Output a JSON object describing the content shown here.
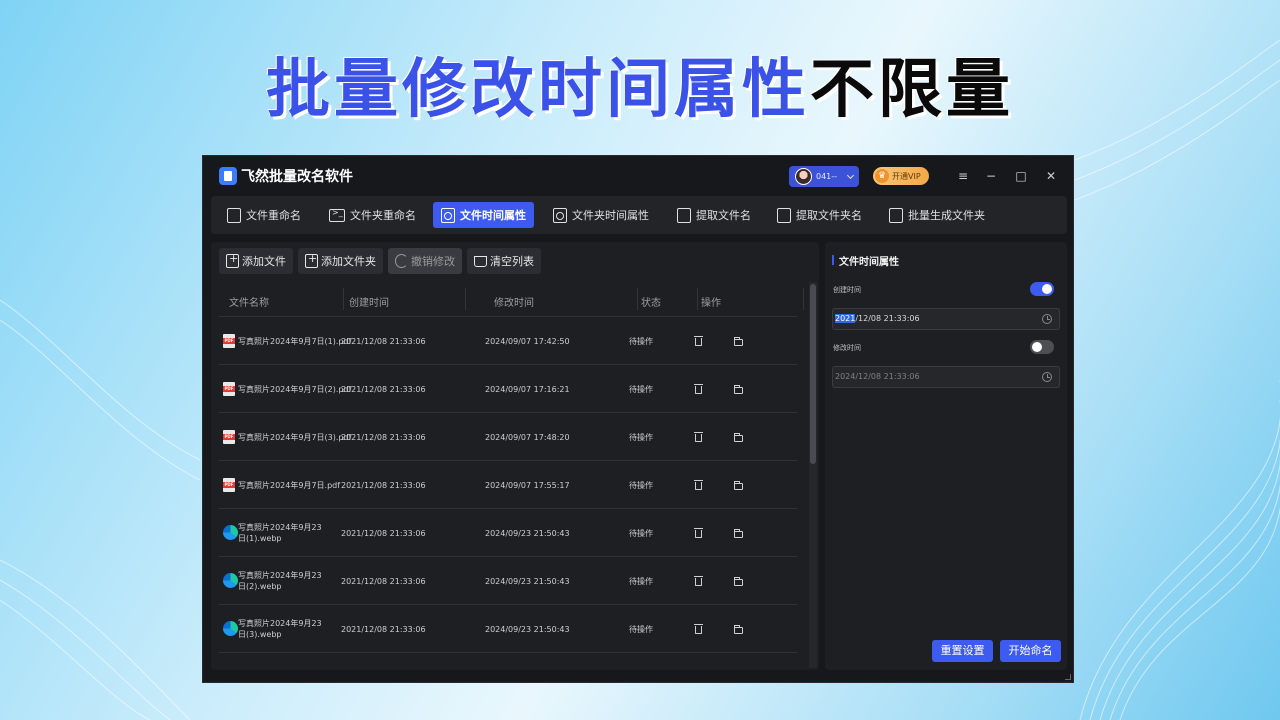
{
  "headline": {
    "blue_part": "批量修改时间属性",
    "black_part": "不限量"
  },
  "window": {
    "app_title": "飞然批量改名软件",
    "user_name": "041--",
    "vip_label": "开通VIP",
    "controls": {
      "menu": "≡",
      "minimize": "−",
      "maximize": "□",
      "close": "✕"
    }
  },
  "tabs": [
    {
      "label": "文件重命名",
      "icon": "file-icon",
      "active": false
    },
    {
      "label": "文件夹重命名",
      "icon": "terminal-folder-icon",
      "active": false
    },
    {
      "label": "文件时间属性",
      "icon": "file-clock-icon",
      "active": true
    },
    {
      "label": "文件夹时间属性",
      "icon": "folder-clock-icon",
      "active": false
    },
    {
      "label": "提取文件名",
      "icon": "extract-file-icon",
      "active": false
    },
    {
      "label": "提取文件夹名",
      "icon": "extract-folder-icon",
      "active": false
    },
    {
      "label": "批量生成文件夹",
      "icon": "generate-folder-icon",
      "active": false
    }
  ],
  "toolbar": {
    "add_file": "添加文件",
    "add_folder": "添加文件夹",
    "undo": "撤销修改",
    "clear_list": "清空列表"
  },
  "table": {
    "columns": [
      "文件名称",
      "创建时间",
      "修改时间",
      "状态",
      "操作"
    ],
    "rows": [
      {
        "type": "pdf",
        "name": "写真照片2024年9月7日(1).pdf",
        "created": "2021/12/08 21:33:06",
        "modified": "2024/09/07 17:42:50",
        "status": "待操作"
      },
      {
        "type": "pdf",
        "name": "写真照片2024年9月7日(2).pdf",
        "created": "2021/12/08 21:33:06",
        "modified": "2024/09/07 17:16:21",
        "status": "待操作"
      },
      {
        "type": "pdf",
        "name": "写真照片2024年9月7日(3).pdf",
        "created": "2021/12/08 21:33:06",
        "modified": "2024/09/07 17:48:20",
        "status": "待操作"
      },
      {
        "type": "pdf",
        "name": "写真照片2024年9月7日.pdf",
        "created": "2021/12/08 21:33:06",
        "modified": "2024/09/07 17:55:17",
        "status": "待操作"
      },
      {
        "type": "webp",
        "name": "写真照片2024年9月23日(1).webp",
        "created": "2021/12/08 21:33:06",
        "modified": "2024/09/23 21:50:43",
        "status": "待操作"
      },
      {
        "type": "webp",
        "name": "写真照片2024年9月23日(2).webp",
        "created": "2021/12/08 21:33:06",
        "modified": "2024/09/23 21:50:43",
        "status": "待操作"
      },
      {
        "type": "webp",
        "name": "写真照片2024年9月23日(3).webp",
        "created": "2021/12/08 21:33:06",
        "modified": "2024/09/23 21:50:43",
        "status": "待操作"
      }
    ]
  },
  "settings": {
    "title": "文件时间属性",
    "created_label": "创建时间",
    "created_enabled": true,
    "created_value_selected": "2021",
    "created_value_rest": "/12/08 21:33:06",
    "modified_label": "修改时间",
    "modified_enabled": false,
    "modified_value": "2024/12/08 21:33:06",
    "reset_button": "重置设置",
    "start_button": "开始命名"
  },
  "colors": {
    "accent": "#3d5bf0",
    "headline_blue": "#3a52e8",
    "window_bg": "#17181b",
    "vip": "#f3a948"
  }
}
